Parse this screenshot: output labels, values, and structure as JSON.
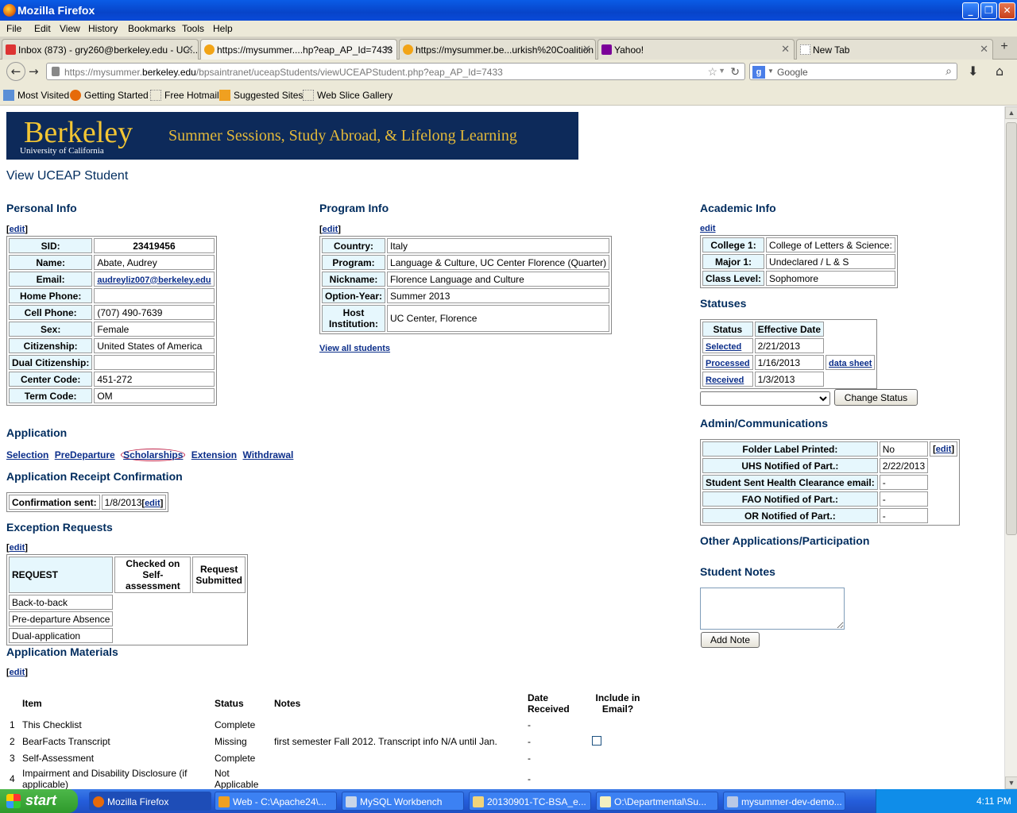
{
  "window": {
    "title": "Mozilla Firefox"
  },
  "menu": [
    "File",
    "Edit",
    "View",
    "History",
    "Bookmarks",
    "Tools",
    "Help"
  ],
  "tabs": [
    {
      "label": "Inbox (873) - gry260@berkeley.edu - UC...",
      "icon": "gmail-icon"
    },
    {
      "label": "https://mysummer....hp?eap_AP_Id=7433",
      "icon": "sun-icon",
      "active": true
    },
    {
      "label": "https://mysummer.be...urkish%20Coalition",
      "icon": "sun-icon"
    },
    {
      "label": "Yahoo!",
      "icon": "yahoo-icon"
    },
    {
      "label": "New Tab",
      "icon": "blank-page-icon"
    }
  ],
  "url": {
    "prefix": "https://mysummer.",
    "domain": "berkeley.edu",
    "path": "/bpsaintranet/uceapStudents/viewUCEAPStudent.php?eap_AP_Id=7433"
  },
  "search": {
    "engine": "Google"
  },
  "bookmarks": [
    "Most Visited",
    "Getting Started",
    "Free Hotmail",
    "Suggested Sites",
    "Web Slice Gallery"
  ],
  "banner": {
    "logo": "Berkeley",
    "sub": "University of California",
    "tagline": "Summer Sessions, Study Abroad, & Lifelong Learning"
  },
  "page": {
    "title": "View UCEAP Student",
    "edit": "[edit]",
    "edit_plain": "edit"
  },
  "personal": {
    "heading": "Personal Info",
    "rows": [
      {
        "label": "SID:",
        "value": "23419456"
      },
      {
        "label": "Name:",
        "value": "Abate, Audrey"
      },
      {
        "label": "Email:",
        "value": "audreyliz007@berkeley.edu"
      },
      {
        "label": "Home Phone:",
        "value": ""
      },
      {
        "label": "Cell Phone:",
        "value": "(707) 490-7639"
      },
      {
        "label": "Sex:",
        "value": "Female"
      },
      {
        "label": "Citizenship:",
        "value": "United States of America"
      },
      {
        "label": "Dual Citizenship:",
        "value": ""
      },
      {
        "label": "Center Code:",
        "value": "451-272"
      },
      {
        "label": "Term Code:",
        "value": "OM"
      }
    ]
  },
  "program": {
    "heading": "Program Info",
    "rows": [
      {
        "label": "Country:",
        "value": "Italy"
      },
      {
        "label": "Program:",
        "value": "Language & Culture, UC Center Florence (Quarter)"
      },
      {
        "label": "Nickname:",
        "value": "Florence Language and Culture"
      },
      {
        "label": "Option-Year:",
        "value": "Summer 2013"
      },
      {
        "label": "Host Institution:",
        "value": "UC Center, Florence"
      }
    ],
    "view_all": "View all students"
  },
  "academic": {
    "heading": "Academic Info",
    "rows": [
      {
        "label": "College 1:",
        "value": "College of Letters & Science:"
      },
      {
        "label": "Major 1:",
        "value": "Undeclared / L & S"
      },
      {
        "label": "Class Level:",
        "value": "Sophomore"
      }
    ]
  },
  "statuses": {
    "heading": "Statuses",
    "col_status": "Status",
    "col_date": "Effective Date",
    "rows": [
      {
        "status": "Selected",
        "date": "2/21/2013",
        "extra": ""
      },
      {
        "status": "Processed",
        "date": "1/16/2013",
        "extra": "data sheet"
      },
      {
        "status": "Received",
        "date": "1/3/2013",
        "extra": ""
      }
    ],
    "change_button": "Change Status"
  },
  "admin": {
    "heading": "Admin/Communications",
    "rows": [
      {
        "label": "Folder Label Printed:",
        "value": "No"
      },
      {
        "label": "UHS Notified of Part.:",
        "value": "2/22/2013"
      },
      {
        "label": "Student Sent Health Clearance email:",
        "value": "-"
      },
      {
        "label": "FAO Notified of Part.:",
        "value": "-"
      },
      {
        "label": "OR Notified of Part.:",
        "value": "-"
      }
    ]
  },
  "other_apps": {
    "heading": "Other Applications/Participation"
  },
  "notes": {
    "heading": "Student Notes",
    "button": "Add Note"
  },
  "application": {
    "heading": "Application",
    "links": [
      "Selection",
      "PreDeparture",
      "Scholarships",
      "Extension",
      "Withdrawal"
    ]
  },
  "receipt": {
    "heading": "Application Receipt Confirmation",
    "label": "Confirmation sent:",
    "value": "1/8/2013"
  },
  "exceptions": {
    "heading": "Exception Requests",
    "col_request": "REQUEST",
    "col_checked": "Checked on Self-assessment",
    "col_submitted": "Request Submitted",
    "rows": [
      "Back-to-back",
      "Pre-departure Absence",
      "Dual-application"
    ]
  },
  "materials": {
    "heading": "Application Materials",
    "cols": {
      "item": "Item",
      "status": "Status",
      "notes": "Notes",
      "date": "Date Received",
      "include": "Include in Email?"
    },
    "rows": [
      {
        "n": "1",
        "item": "This Checklist",
        "status": "Complete",
        "notes": "",
        "date": "-"
      },
      {
        "n": "2",
        "item": "BearFacts Transcript",
        "status": "Missing",
        "notes": "first semester Fall 2012. Transcript info N/A until Jan.",
        "date": "-"
      },
      {
        "n": "3",
        "item": "Self-Assessment",
        "status": "Complete",
        "notes": "",
        "date": "-"
      },
      {
        "n": "4",
        "item": "Impairment and Disability Disclosure (if applicable)",
        "status": "Not Applicable",
        "notes": "",
        "date": "-"
      }
    ]
  },
  "taskbar": {
    "start": "start",
    "tasks": [
      "Mozilla Firefox",
      "Web - C:\\Apache24\\...",
      "MySQL Workbench",
      "20130901-TC-BSA_e...",
      "O:\\Departmental\\Su...",
      "mysummer-dev-demo..."
    ],
    "clock": "4:11 PM"
  }
}
